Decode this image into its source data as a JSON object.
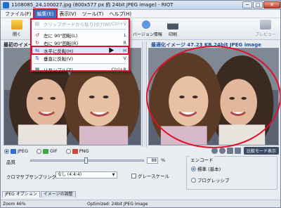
{
  "window": {
    "title": "1108085_24.100027.jpg (800x577 px 約 24bit JPEG image) - RIOT",
    "min_label": "─",
    "max_label": "□",
    "close_label": "✕"
  },
  "menubar": {
    "items": [
      "ファイル(F)",
      "編集(E)",
      "表示(V)",
      "ツール(T)",
      "ヘルプ(H)"
    ],
    "active_index": 1
  },
  "toolbar": {
    "tools": [
      {
        "label": "開く",
        "icon": "open-folder-icon"
      },
      {
        "label": "",
        "icon": "save-icon"
      },
      {
        "label": "バージョン情報",
        "icon": "info-icon"
      },
      {
        "label": "印刷",
        "icon": "print-icon"
      },
      {
        "label": "プレビュー",
        "icon": "preview-icon"
      }
    ]
  },
  "edit_menu": {
    "items": [
      {
        "label": "クリップボードから貼り付け(W)",
        "shortcut": "Ctrl+V",
        "icon": "paste-icon",
        "disabled": true
      },
      {
        "label": "左に 90°回転(L)",
        "shortcut": "L",
        "icon": "rotate-left-icon",
        "disabled": false
      },
      {
        "label": "右に 90°回転(R)",
        "shortcut": "R",
        "icon": "rotate-right-icon",
        "disabled": false
      },
      {
        "label": "水平に反転(H)",
        "shortcut": "H",
        "icon": "flip-horizontal-icon",
        "disabled": false,
        "highlighted": true
      },
      {
        "label": "垂直に反転(V)",
        "shortcut": "V",
        "icon": "flip-vertical-icon",
        "disabled": false
      },
      {
        "label": "リサンプル(Z)",
        "shortcut": "Ctrl+R",
        "icon": "resample-icon",
        "disabled": false
      }
    ]
  },
  "panels": {
    "left_label": "最初のイメージ",
    "right_label": "最適化イメージ  47.23 KB  24bit JPEG image"
  },
  "format_tabs": {
    "items": [
      "JPEG",
      "GIF",
      "PNG"
    ],
    "selected": "JPEG",
    "view_button": "比較モード表示"
  },
  "settings": {
    "quality_label": "品質",
    "quality_value": "88",
    "quality_fraction": 0.88,
    "percent_label": "%",
    "subsampling_label": "クロマサブサンプリング",
    "subsampling_value": "なし (4:4:4)",
    "grayscale_label": "グレースケール",
    "options_legend": "エンコード",
    "radio_options": [
      "標準 (基本)",
      "プログレッシブ"
    ],
    "radio_selected": 0
  },
  "bottom_tabs": {
    "items": [
      "JPEG オプション",
      "イメージの調整"
    ],
    "selected": 0
  },
  "status": {
    "zoom": "Zoom 46%",
    "info": "Optimized: 24bit JPEG image"
  },
  "colors": {
    "highlight_red": "#e0102a",
    "menu_active": "#3a6fc2"
  }
}
